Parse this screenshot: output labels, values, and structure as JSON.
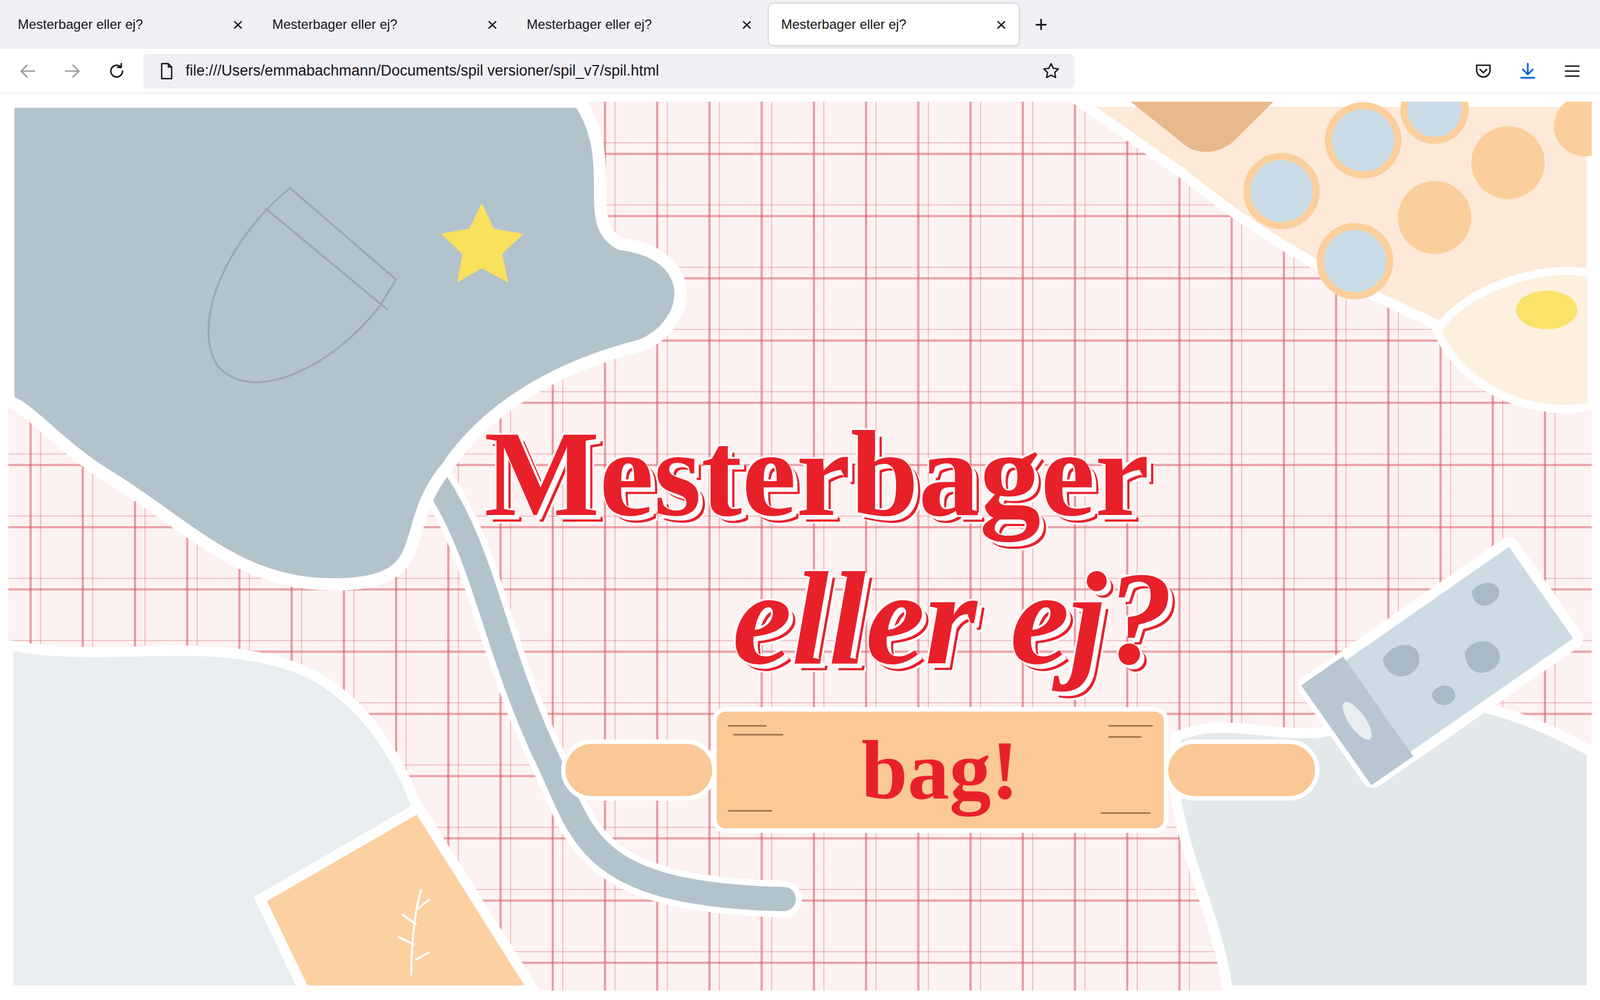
{
  "browser": {
    "tabs": [
      {
        "label": "Mesterbager eller ej?",
        "close": "×",
        "selected": false
      },
      {
        "label": "Mesterbager eller ej?",
        "close": "×",
        "selected": false
      },
      {
        "label": "Mesterbager eller ej?",
        "close": "×",
        "selected": false
      },
      {
        "label": "Mesterbager eller ej?",
        "close": "×",
        "selected": true
      }
    ],
    "new_tab": "+",
    "url": "file:///Users/emmabachmann/Documents/spil versioner/spil_v7/spil.html"
  },
  "game": {
    "title_line1": "Mesterbager",
    "title_line2": "eller ej?",
    "start_button": "bag!"
  }
}
